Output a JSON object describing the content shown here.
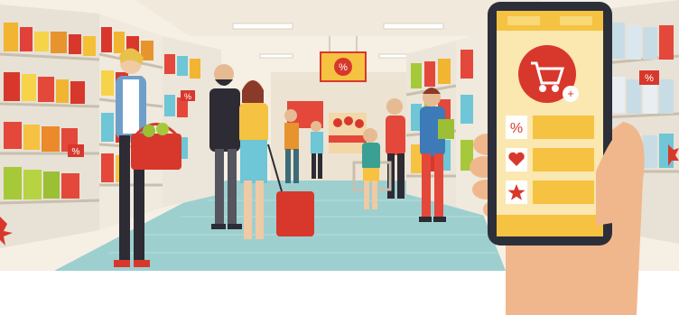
{
  "scene": {
    "description_colors": {
      "accent_red": "#d8382c",
      "accent_yellow": "#f7d34a",
      "floor_teal": "#8fc6c7",
      "wall_cream": "#f3ecdf",
      "phone_dark": "#2c2f3a"
    }
  },
  "store": {
    "sale_sign_icon": "percent-icon",
    "hanging_sign_icons": [
      "percent-icon",
      "percent-icon",
      "percent-icon"
    ]
  },
  "phone_app": {
    "hero_icon": "shopping-cart-add-icon",
    "menu_items": [
      {
        "icon": "percent-icon"
      },
      {
        "icon": "heart-icon"
      },
      {
        "icon": "star-icon"
      }
    ]
  }
}
